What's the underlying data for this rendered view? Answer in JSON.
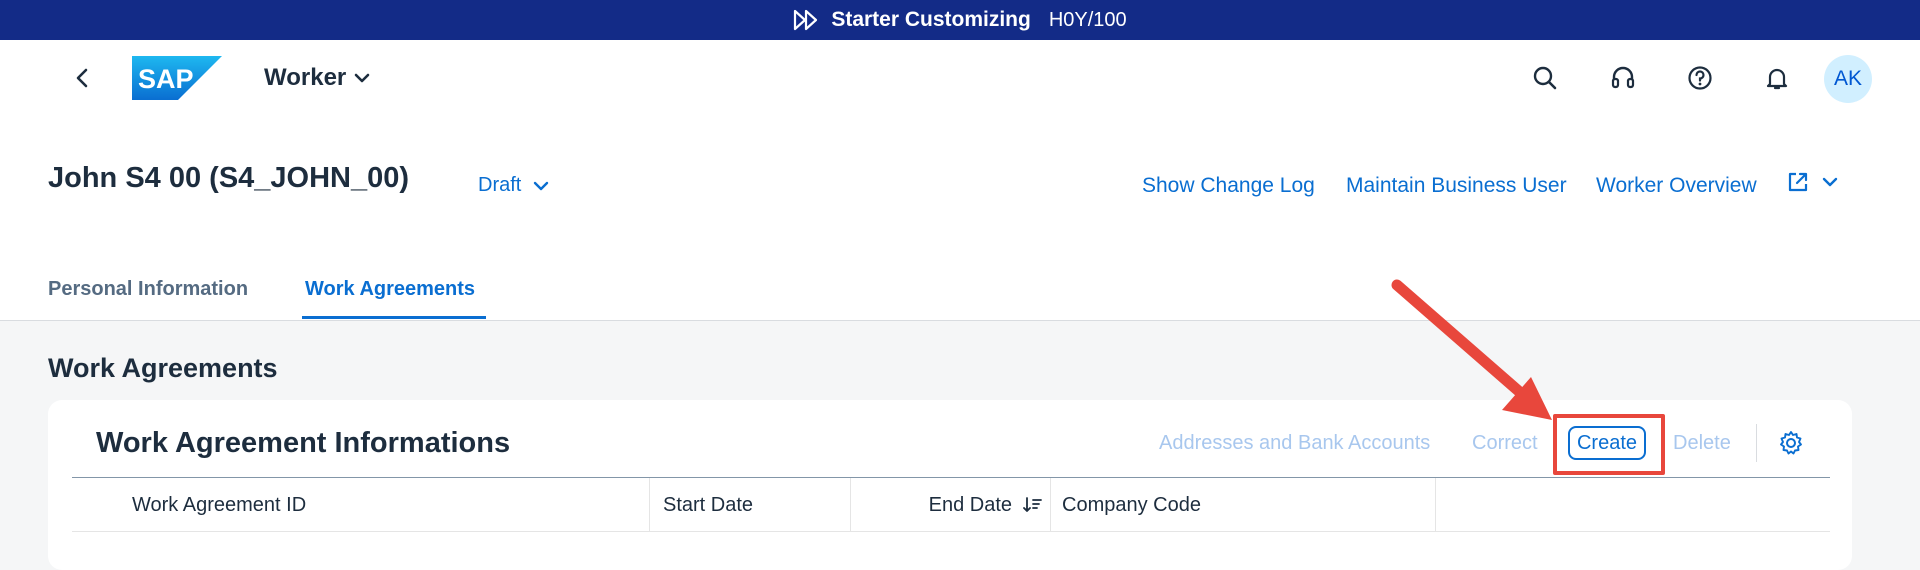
{
  "banner": {
    "title": "Starter Customizing",
    "system": "H0Y/100"
  },
  "shell": {
    "app_title": "Worker",
    "avatar_initials": "AK",
    "logo_text": "SAP"
  },
  "object": {
    "title": "John S4 00 (S4_JOHN_00)",
    "status": "Draft",
    "actions": [
      "Show Change Log",
      "Maintain Business User",
      "Worker Overview"
    ]
  },
  "tabs": [
    {
      "label": "Personal Information",
      "active": false
    },
    {
      "label": "Work Agreements",
      "active": true
    }
  ],
  "section": {
    "title": "Work Agreements",
    "card_title": "Work Agreement Informations",
    "toolbar": {
      "addresses_label": "Addresses and Bank Accounts",
      "correct_label": "Correct",
      "create_label": "Create",
      "delete_label": "Delete"
    },
    "columns": [
      "Work Agreement ID",
      "Start Date",
      "End Date",
      "Company Code"
    ]
  },
  "colors": {
    "banner": "#132b87",
    "link": "#0a6ed1",
    "disabled": "#a8c7ee",
    "annotation": "#e8473c"
  }
}
